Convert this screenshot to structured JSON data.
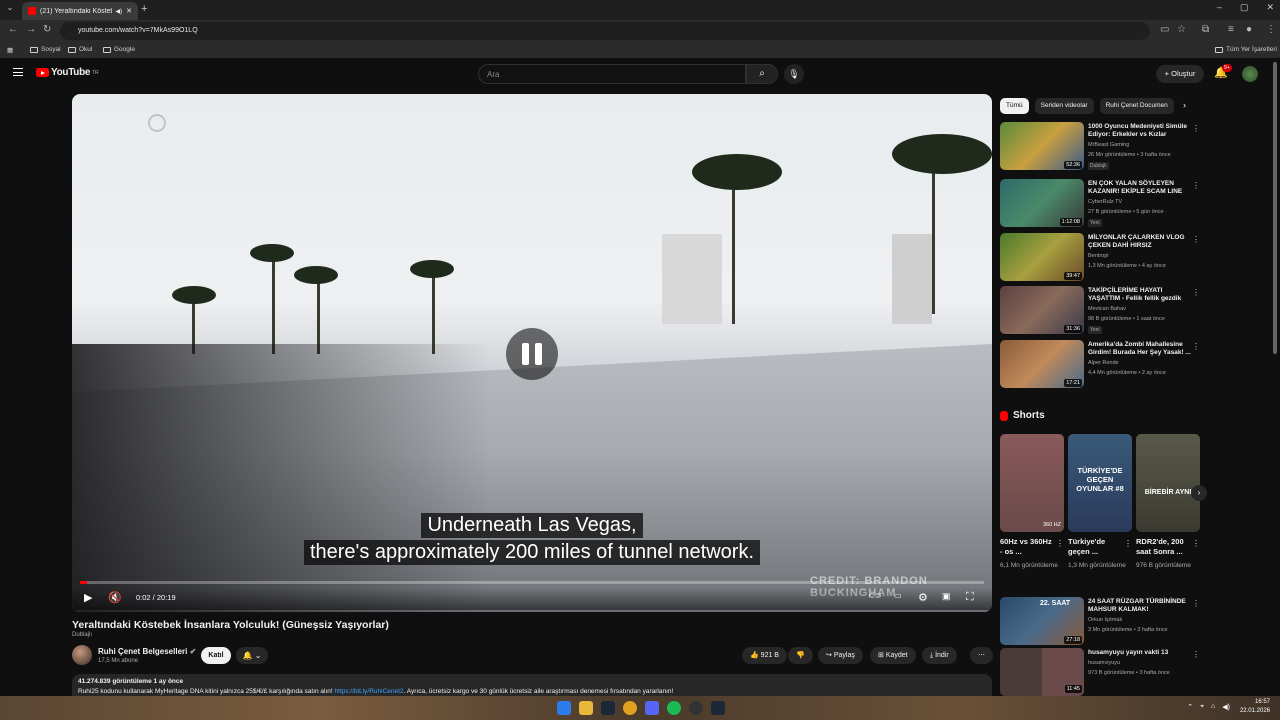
{
  "browser": {
    "tab_title": "(21) Yeraltındaki Köstebek İ",
    "new_tab": "+",
    "url": "youtube.com/watch?v=7MkAs99O1LQ",
    "bookmarks": [
      "Sosyal",
      "Okul",
      "Google"
    ],
    "all_bookmarks": "Tüm Yer İşaretleri"
  },
  "header": {
    "logo": "YouTube",
    "logo_sup": "TR",
    "search_placeholder": "Ara",
    "create_label": "Oluştur",
    "notification_count": "9+"
  },
  "player": {
    "caption_line1": "Underneath Las Vegas,",
    "caption_line2": "there's approximately 200 miles of tunnel network.",
    "credit": "CREDIT: BRANDON BUCKINGHAM",
    "time": "0:02 / 20:19",
    "progress": 0.002
  },
  "video": {
    "title": "Yeraltındaki Köstebek İnsanlara Yolculuk! (Güneşsiz Yaşıyorlar)",
    "dub_tag": "Dublajlı",
    "channel": "Ruhi Çenet Belgeselleri",
    "subscribers": "17,5 Mn abone",
    "join_label": "Katıl",
    "likes": "921 B",
    "share_label": "Paylaş",
    "save_label": "Kaydet",
    "download_label": "İndir",
    "views_date": "41.274.839 görüntüleme  1 ay önce",
    "desc_text": "Ruhi25 kodunu kullanarak MyHeritage DNA kitini yalnızca 25$/€/£ karşılığında satın alın! ",
    "desc_link": "https://bit.ly/RuhiCenet2",
    "desc_tail": ". Ayrıca, ücretsiz kargo ve 30 günlük ücretsiz aile araştırması denemesi fırsatından yararlanın!"
  },
  "chips": [
    "Tümü",
    "Seriden videolar",
    "Ruhi Çenet Documen"
  ],
  "recommendations": [
    {
      "title": "1000 Oyuncu Medeniyeti Simüle Ediyor: Erkekler vs Kızlar",
      "channel": "MrBeast Gaming",
      "meta": "26 Mn görüntüleme • 3 hafta önce",
      "badge": "Dublajlı",
      "duration": "52:36",
      "color": "#5b8a3a"
    },
    {
      "title": "EN ÇOK YALAN SÖYLEYEN KAZANIR! EKİPLE SCAM LINE",
      "channel": "CyberRulz TV",
      "meta": "27 B görüntüleme • 5 gün önce",
      "badge": "Yeni",
      "duration": "1:12:08",
      "color": "#2d6a6a"
    },
    {
      "title": "MİLYONLAR ÇALARKEN VLOG ÇEKEN DAHİ HIRSIZ",
      "channel": "Bentropi",
      "meta": "1,3 Mn görüntüleme • 4 ay önce",
      "badge": "",
      "duration": "39:47",
      "color": "#4a7a2a"
    },
    {
      "title": "TAKİPÇİLERİME HAYATI YAŞATTIM - Fellik fellik gezdik",
      "channel": "Mevtcan Bahav",
      "meta": "98 B görüntüleme • 1 saat önce",
      "badge": "Yeni",
      "duration": "31:36",
      "color": "#5a4040"
    },
    {
      "title": "Amerika'da Zombi Mahallesine Girdim! Burada Her Şey Yasak! ...",
      "channel": "Alper Rende",
      "meta": "4,4 Mn görüntüleme • 2 ay önce",
      "badge": "",
      "duration": "17:21",
      "color": "#8a5a3a"
    }
  ],
  "shorts_title": "Shorts",
  "shorts": [
    {
      "title": "60Hz vs 360Hz - os ...",
      "views": "6,1 Mn görüntüleme",
      "overlay": "360 HZ",
      "color": "#8a5a5a"
    },
    {
      "title": "Türkiye'de geçen ...",
      "views": "1,3 Mn görüntüleme",
      "overlay": "TÜRKİYE'DE GEÇEN OYUNLAR #8",
      "color": "#3a5a7a"
    },
    {
      "title": "RDR2'de, 200 saat Sonra ...",
      "views": "976 B görüntüleme",
      "overlay": "BİREBİR AYNI",
      "color": "#5a5a4a"
    }
  ],
  "more_recs": [
    {
      "title": "24 SAAT RÜZGAR TÜRBİNİNDE MAHSUR KALMAK!",
      "channel": "Orkun Işıtmak",
      "meta": "3 Mn görüntüleme • 3 hafta önce",
      "duration": "27:18",
      "overlay": "22. SAAT",
      "color": "#2a4a6a"
    },
    {
      "title": "husamyuyu yayın vakti 13",
      "channel": "husamviyuyu",
      "meta": "973 B görüntüleme • 3 hafta önce",
      "duration": "11:45",
      "color": "#6a4a4a"
    }
  ],
  "taskbar": {
    "time": "16:57",
    "date": "22.01.2026"
  },
  "colors": {
    "brand_red": "#ff0000",
    "link_blue": "#3ea6ff",
    "bg": "#0f0f0f"
  }
}
